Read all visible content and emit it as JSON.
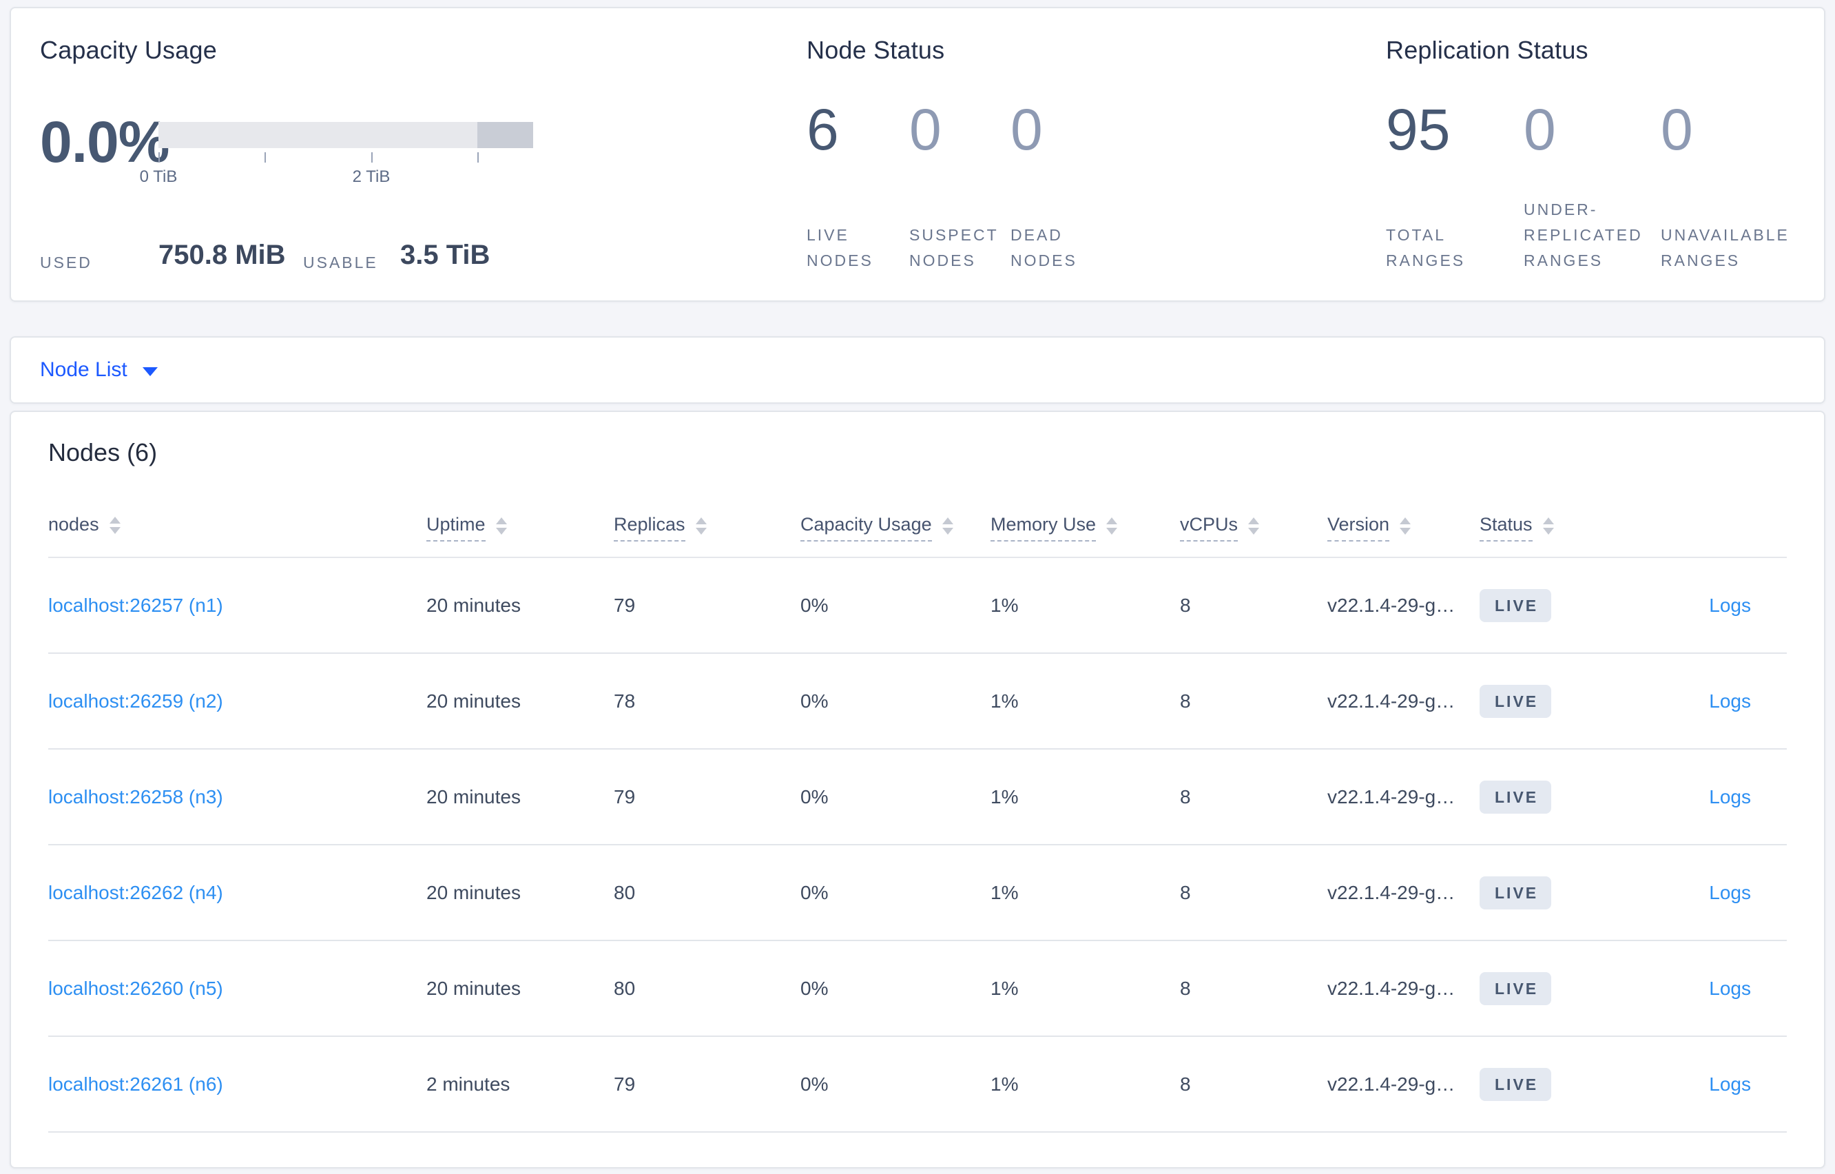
{
  "capacity": {
    "title": "Capacity Usage",
    "percent": "0.0%",
    "tick_labels": [
      "0 TiB",
      "2 TiB"
    ],
    "used_label": "USED",
    "used_value": "750.8 MiB",
    "usable_label": "USABLE",
    "usable_value": "3.5 TiB"
  },
  "node_status": {
    "title": "Node Status",
    "metrics": [
      {
        "value": "6",
        "label": "LIVE NODES",
        "emphasized": true
      },
      {
        "value": "0",
        "label": "SUSPECT NODES",
        "emphasized": false
      },
      {
        "value": "0",
        "label": "DEAD NODES",
        "emphasized": false
      }
    ]
  },
  "replication_status": {
    "title": "Replication Status",
    "metrics": [
      {
        "value": "95",
        "label": "TOTAL RANGES",
        "emphasized": true
      },
      {
        "value": "0",
        "label": "UNDER-REPLICATED RANGES",
        "emphasized": false
      },
      {
        "value": "0",
        "label": "UNAVAILABLE RANGES",
        "emphasized": false
      }
    ]
  },
  "view_selector": {
    "label": "Node List"
  },
  "nodes_table": {
    "title": "Nodes (6)",
    "columns": [
      {
        "label": "nodes",
        "underline": false
      },
      {
        "label": "Uptime",
        "underline": true
      },
      {
        "label": "Replicas",
        "underline": true
      },
      {
        "label": "Capacity Usage",
        "underline": true
      },
      {
        "label": "Memory Use",
        "underline": true
      },
      {
        "label": "vCPUs",
        "underline": true
      },
      {
        "label": "Version",
        "underline": true
      },
      {
        "label": "Status",
        "underline": true
      },
      {
        "label": "",
        "underline": false
      }
    ],
    "rows": [
      {
        "node": "localhost:26257 (n1)",
        "uptime": "20 minutes",
        "replicas": "79",
        "capacity_usage": "0%",
        "memory_use": "1%",
        "vcpus": "8",
        "version": "v22.1.4-29-g…",
        "status": "LIVE",
        "logs": "Logs"
      },
      {
        "node": "localhost:26259 (n2)",
        "uptime": "20 minutes",
        "replicas": "78",
        "capacity_usage": "0%",
        "memory_use": "1%",
        "vcpus": "8",
        "version": "v22.1.4-29-g…",
        "status": "LIVE",
        "logs": "Logs"
      },
      {
        "node": "localhost:26258 (n3)",
        "uptime": "20 minutes",
        "replicas": "79",
        "capacity_usage": "0%",
        "memory_use": "1%",
        "vcpus": "8",
        "version": "v22.1.4-29-g…",
        "status": "LIVE",
        "logs": "Logs"
      },
      {
        "node": "localhost:26262 (n4)",
        "uptime": "20 minutes",
        "replicas": "80",
        "capacity_usage": "0%",
        "memory_use": "1%",
        "vcpus": "8",
        "version": "v22.1.4-29-g…",
        "status": "LIVE",
        "logs": "Logs"
      },
      {
        "node": "localhost:26260 (n5)",
        "uptime": "20 minutes",
        "replicas": "80",
        "capacity_usage": "0%",
        "memory_use": "1%",
        "vcpus": "8",
        "version": "v22.1.4-29-g…",
        "status": "LIVE",
        "logs": "Logs"
      },
      {
        "node": "localhost:26261 (n6)",
        "uptime": "2 minutes",
        "replicas": "79",
        "capacity_usage": "0%",
        "memory_use": "1%",
        "vcpus": "8",
        "version": "v22.1.4-29-g…",
        "status": "LIVE",
        "logs": "Logs"
      }
    ]
  },
  "colors": {
    "page_background": "#f4f5f9",
    "card_background": "#ffffff",
    "accent_dark_slate": "#475872",
    "muted_number": "#8e9ab3",
    "link_blue": "#2d8ff2",
    "selector_blue": "#1c59ff",
    "badge_background": "#e4e9f1",
    "badge_text": "#475770",
    "bar_light": "#e7e8ec",
    "bar_dark": "#c9cdd6"
  }
}
